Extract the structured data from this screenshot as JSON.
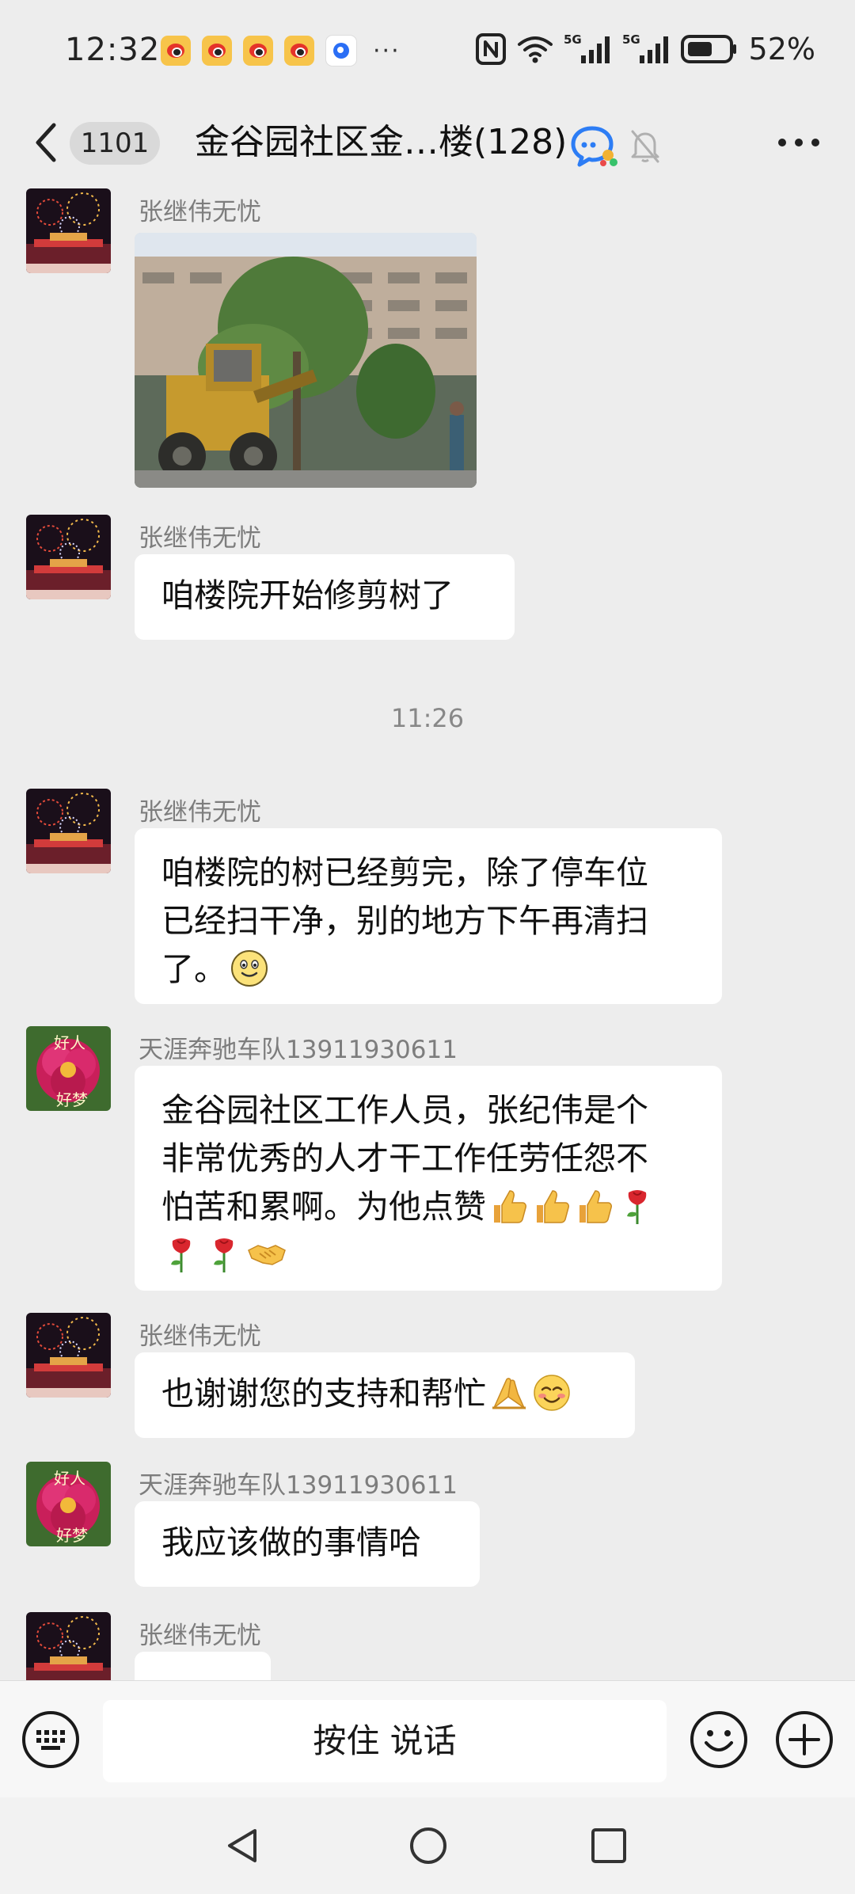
{
  "status_bar": {
    "time": "12:32",
    "notification_icons": [
      "weibo-icon",
      "weibo-icon",
      "weibo-icon",
      "weibo-icon",
      "browser-icon"
    ],
    "more_indicator": "···",
    "battery_percent": "52%",
    "network_labels": [
      "5G",
      "5G"
    ]
  },
  "header": {
    "unread_count": "1101",
    "title": "金谷园社区金…楼(128)",
    "icons": [
      "chat-bubble-icon",
      "mute-bell-icon",
      "more-icon"
    ]
  },
  "messages": [
    {
      "type": "image",
      "sender": "张继伟无忧",
      "avatar": "fireworks",
      "alt_icon": "photo-excavator-tree"
    },
    {
      "type": "text",
      "sender": "张继伟无忧",
      "avatar": "fireworks",
      "lines": [
        "咱楼院开始修剪树了"
      ]
    },
    {
      "type": "time",
      "text": "11:26"
    },
    {
      "type": "text",
      "sender": "张继伟无忧",
      "avatar": "fireworks",
      "lines": [
        "咱楼院的树已经剪完，除了停车位",
        "已经扫干净，别的地方下午再清扫",
        "了。"
      ],
      "trailing_emoji": [
        "smile-emoji"
      ]
    },
    {
      "type": "text",
      "sender": "天涯奔驰车队13911930611",
      "avatar": "peony",
      "avatar_text": [
        "好人",
        "好梦"
      ],
      "lines": [
        "金谷园社区工作人员，张纪伟是个",
        "非常优秀的人才干工作任劳任怨不",
        "怕苦和累啊。为他点赞"
      ],
      "trailing_emoji": [
        "thumbs-up-emoji",
        "thumbs-up-emoji",
        "thumbs-up-emoji",
        "rose-emoji",
        "rose-emoji",
        "rose-emoji",
        "handshake-emoji"
      ]
    },
    {
      "type": "text",
      "sender": "张继伟无忧",
      "avatar": "fireworks",
      "lines": [
        "也谢谢您的支持和帮忙"
      ],
      "trailing_emoji": [
        "folded-hands-emoji",
        "blush-emoji"
      ]
    },
    {
      "type": "text",
      "sender": "天涯奔驰车队13911930611",
      "avatar": "peony",
      "avatar_text": [
        "好人",
        "好梦"
      ],
      "lines": [
        "我应该做的事情哈"
      ]
    },
    {
      "type": "text",
      "sender": "张继伟无忧",
      "avatar": "fireworks",
      "lines": []
    }
  ],
  "input_bar": {
    "hold_to_talk_label": "按住 说话",
    "icons": [
      "keyboard-icon",
      "emoji-icon",
      "plus-icon"
    ]
  },
  "nav_bar": {
    "icons": [
      "nav-back-icon",
      "nav-home-icon",
      "nav-recents-icon"
    ]
  },
  "colors": {
    "background": "#ededed",
    "bubble": "#ffffff",
    "sender_text": "#7d7d7d",
    "time_divider": "#888888"
  }
}
